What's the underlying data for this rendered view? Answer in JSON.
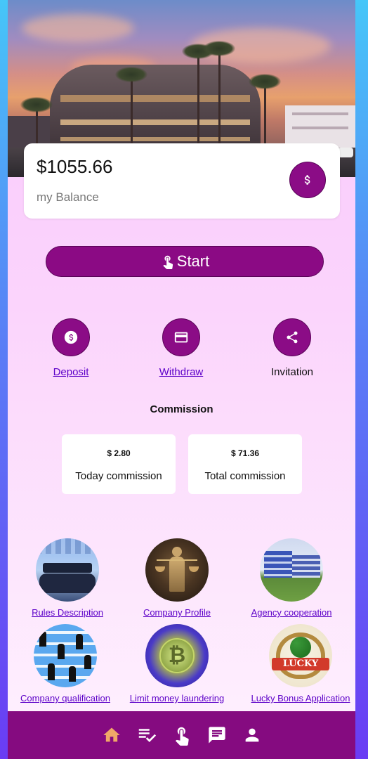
{
  "balance": {
    "amount": "$1055.66",
    "label": "my Balance",
    "button_icon": "dollar-icon"
  },
  "start": {
    "label": "Start",
    "icon": "tap-icon"
  },
  "actions": [
    {
      "label": "Deposit",
      "icon": "dollar-circle-icon"
    },
    {
      "label": "Withdraw",
      "icon": "card-icon"
    },
    {
      "label": "Invitation",
      "icon": "share-icon"
    }
  ],
  "commission": {
    "title": "Commission",
    "cards": [
      {
        "value": "$ 2.80",
        "label": "Today commission"
      },
      {
        "value": "$ 71.36",
        "label": "Total commission"
      }
    ]
  },
  "tiles": [
    {
      "label": "Rules Description"
    },
    {
      "label": "Company Profile"
    },
    {
      "label": "Agency cooperation"
    },
    {
      "label": "Company qualification"
    },
    {
      "label": "Limit money laundering"
    },
    {
      "label": "Lucky Bonus Application"
    }
  ],
  "lucky_image_text": "LUCKY",
  "tabbar": [
    "home-icon",
    "task-list-icon",
    "tap-icon",
    "message-icon",
    "person-icon"
  ],
  "colors": {
    "primary": "#8b0c86",
    "active_tab": "#f0a868",
    "link": "#5c00c8"
  }
}
